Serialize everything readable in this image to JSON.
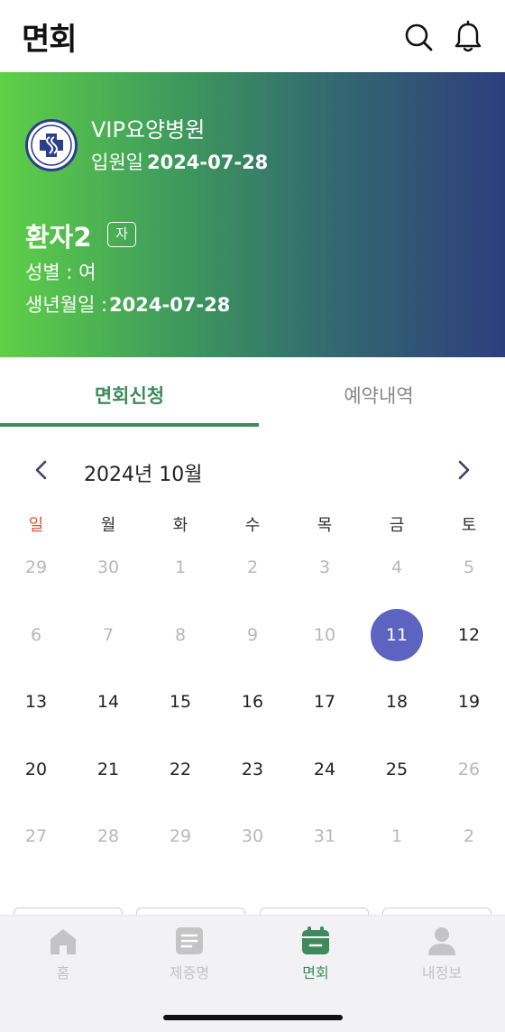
{
  "header": {
    "title": "면회"
  },
  "banner": {
    "hospital_name": "VIP요양병원",
    "admission_label": "입원일",
    "admission_date": "2024-07-28",
    "patient_name": "환자2",
    "patient_badge": "자",
    "gender": "성별 : 여",
    "birth_label": "생년월일 :",
    "birth_date": "2024-07-28"
  },
  "tabs": [
    {
      "label": "면회신청",
      "active": true
    },
    {
      "label": "예약내역",
      "active": false
    }
  ],
  "calendar": {
    "month_label": "2024년 10월",
    "weekdays": [
      "일",
      "월",
      "화",
      "수",
      "목",
      "금",
      "토"
    ],
    "weeks": [
      [
        {
          "d": "29",
          "muted": true
        },
        {
          "d": "30",
          "muted": true
        },
        {
          "d": "1",
          "muted": true
        },
        {
          "d": "2",
          "muted": true
        },
        {
          "d": "3",
          "muted": true
        },
        {
          "d": "4",
          "muted": true
        },
        {
          "d": "5",
          "muted": true
        }
      ],
      [
        {
          "d": "6",
          "muted": true
        },
        {
          "d": "7",
          "muted": true
        },
        {
          "d": "8",
          "muted": true
        },
        {
          "d": "9",
          "muted": true
        },
        {
          "d": "10",
          "muted": true
        },
        {
          "d": "11",
          "muted": false,
          "selected": true
        },
        {
          "d": "12",
          "muted": false
        }
      ],
      [
        {
          "d": "13",
          "muted": false
        },
        {
          "d": "14",
          "muted": false
        },
        {
          "d": "15",
          "muted": false
        },
        {
          "d": "16",
          "muted": false
        },
        {
          "d": "17",
          "muted": false
        },
        {
          "d": "18",
          "muted": false
        },
        {
          "d": "19",
          "muted": false
        }
      ],
      [
        {
          "d": "20",
          "muted": false
        },
        {
          "d": "21",
          "muted": false
        },
        {
          "d": "22",
          "muted": false
        },
        {
          "d": "23",
          "muted": false
        },
        {
          "d": "24",
          "muted": false
        },
        {
          "d": "25",
          "muted": false
        },
        {
          "d": "26",
          "muted": true
        }
      ],
      [
        {
          "d": "27",
          "muted": true
        },
        {
          "d": "28",
          "muted": true
        },
        {
          "d": "29",
          "muted": true
        },
        {
          "d": "30",
          "muted": true
        },
        {
          "d": "31",
          "muted": true
        },
        {
          "d": "1",
          "muted": true
        },
        {
          "d": "2",
          "muted": true
        }
      ]
    ]
  },
  "bottom_nav": [
    {
      "label": "홈",
      "icon": "home-icon",
      "active": false
    },
    {
      "label": "제증명",
      "icon": "document-icon",
      "active": false
    },
    {
      "label": "면회",
      "icon": "calendar-icon",
      "active": true
    },
    {
      "label": "내정보",
      "icon": "person-icon",
      "active": false
    }
  ],
  "colors": {
    "brand_green": "#3d8b5c",
    "selected_day": "#5d63c1",
    "sunday": "#e0513f",
    "banner_start": "#5fd047",
    "banner_end": "#2d3e7d"
  }
}
